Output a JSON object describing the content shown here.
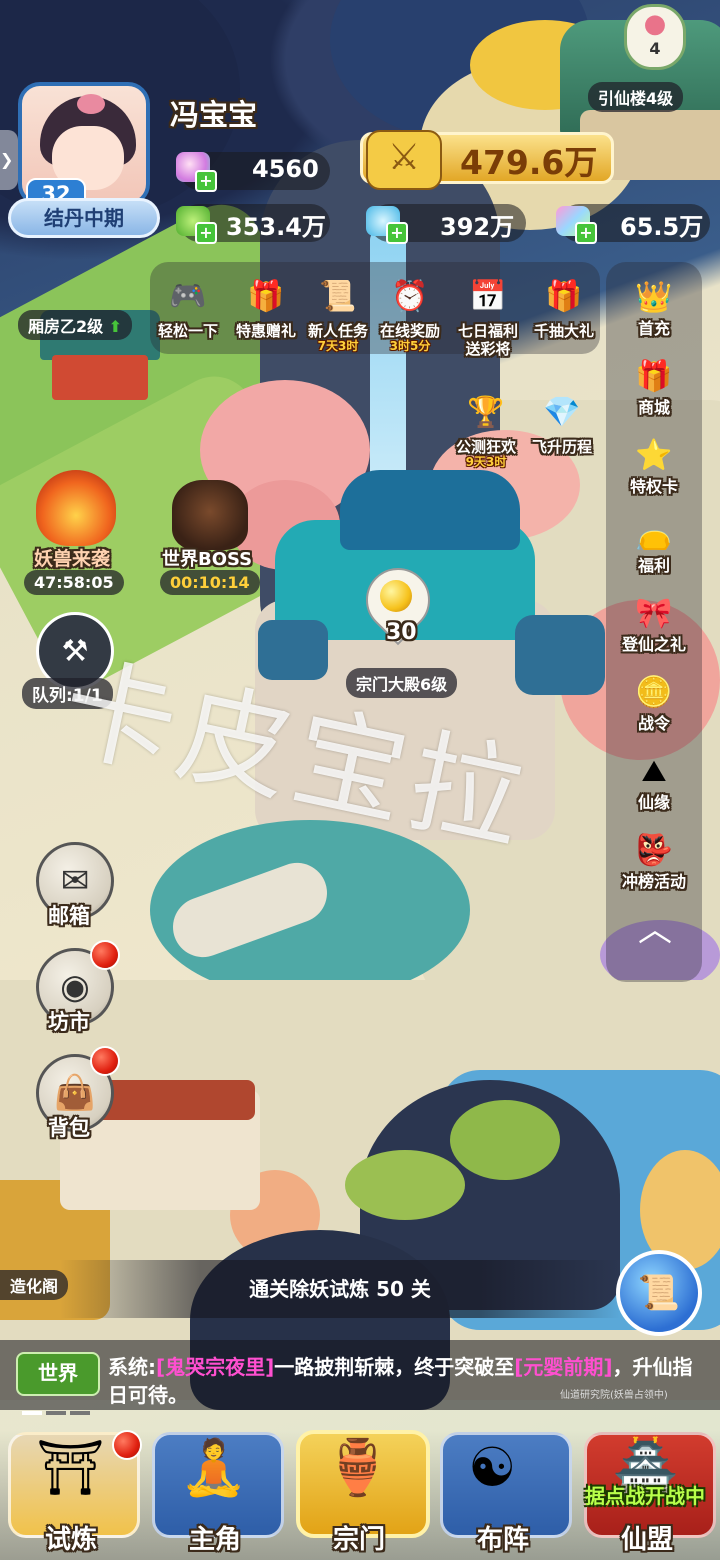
{
  "player": {
    "name": "冯宝宝",
    "level": "32",
    "realm": "结丹中期"
  },
  "resources": {
    "power": "479.6万",
    "gem_pink": "4560",
    "res_green": "353.4万",
    "res_blue": "392万",
    "res_rainbow": "65.5万"
  },
  "top_right": {
    "badge_count": "4",
    "label": "引仙楼4级"
  },
  "buildings": {
    "wing_room": "厢房乙2级",
    "main_hall": "宗门大殿6级",
    "main_hall_bubble": "30",
    "creation_pavilion": "造化阁",
    "small_sign": "仙道研究院(妖兽占领中)"
  },
  "top_events": [
    {
      "name": "relax",
      "label": "轻松一下",
      "sub": "",
      "icon": "gamepad-icon"
    },
    {
      "name": "special-gift",
      "label": "特惠赠礼",
      "sub": "",
      "icon": "gift-flower-icon"
    },
    {
      "name": "newbie-task",
      "label": "新人任务",
      "sub": "7天3时",
      "icon": "scroll-icon"
    },
    {
      "name": "online-reward",
      "label": "在线奖励",
      "sub": "3时5分",
      "icon": "clock-icon"
    },
    {
      "name": "seven-day",
      "label": "七日福利\n送彩将",
      "sub": "",
      "icon": "calendar-icon"
    },
    {
      "name": "thousand-draw",
      "label": "千抽大礼",
      "sub": "",
      "icon": "giftbox-icon"
    }
  ],
  "mid_events": [
    {
      "name": "beta-carnival",
      "label": "公测狂欢",
      "sub": "9天3时",
      "icon": "treasure-icon"
    },
    {
      "name": "ascension",
      "label": "飞升历程",
      "sub": "",
      "icon": "crystal-icon"
    }
  ],
  "right_menu": [
    {
      "name": "first-charge",
      "label": "首充",
      "icon": "crown-badge-icon"
    },
    {
      "name": "shop",
      "label": "商城",
      "icon": "purple-gift-icon"
    },
    {
      "name": "privilege-card",
      "label": "特权卡",
      "icon": "star-card-icon"
    },
    {
      "name": "welfare",
      "label": "福利",
      "icon": "red-bag-icon"
    },
    {
      "name": "immortal-gift",
      "label": "登仙之礼",
      "icon": "golden-gift-icon"
    },
    {
      "name": "battle-pass",
      "label": "战令",
      "icon": "token-icon"
    },
    {
      "name": "fate",
      "label": "仙缘",
      "icon": "mountain-icon"
    },
    {
      "name": "rank-event",
      "label": "冲榜活动",
      "icon": "demon-mask-icon"
    }
  ],
  "left_events": {
    "beast_attack": {
      "label": "妖兽来袭",
      "timer": "47:58:05"
    },
    "world_boss": {
      "label": "世界BOSS",
      "timer": "00:10:14"
    },
    "queue": "队列:1/1"
  },
  "left_menu": [
    {
      "name": "mailbox",
      "label": "邮箱",
      "icon": "envelope-icon",
      "dot": false
    },
    {
      "name": "market",
      "label": "坊市",
      "icon": "coin-icon",
      "dot": true
    },
    {
      "name": "backpack",
      "label": "背包",
      "icon": "bag-icon",
      "dot": true
    }
  ],
  "watermark": "卡皮宝拉",
  "quest_banner": "通关除妖试炼 50 关",
  "chat": {
    "channel": "世界",
    "prefix": "系统:",
    "p1": "[鬼哭宗夜里]",
    "p2": "一路披荆斩棘，终于突破至",
    "p3": "[元婴前期]",
    "p4": "，升仙指日可待。"
  },
  "bottom_nav": [
    {
      "name": "trial",
      "label": "试炼",
      "dot": true
    },
    {
      "name": "hero",
      "label": "主角",
      "dot": false
    },
    {
      "name": "sect",
      "label": "宗门",
      "dot": false,
      "active": true
    },
    {
      "name": "formation",
      "label": "布阵",
      "dot": false
    },
    {
      "name": "alliance",
      "label": "仙盟",
      "dot": false,
      "banner": "据点战开战中"
    }
  ],
  "colors": {
    "accent_gold": "#f2c23a",
    "chat_highlight": "#ff4fd0",
    "timer_gold": "#ffcf3a",
    "green": "#46c43a"
  }
}
